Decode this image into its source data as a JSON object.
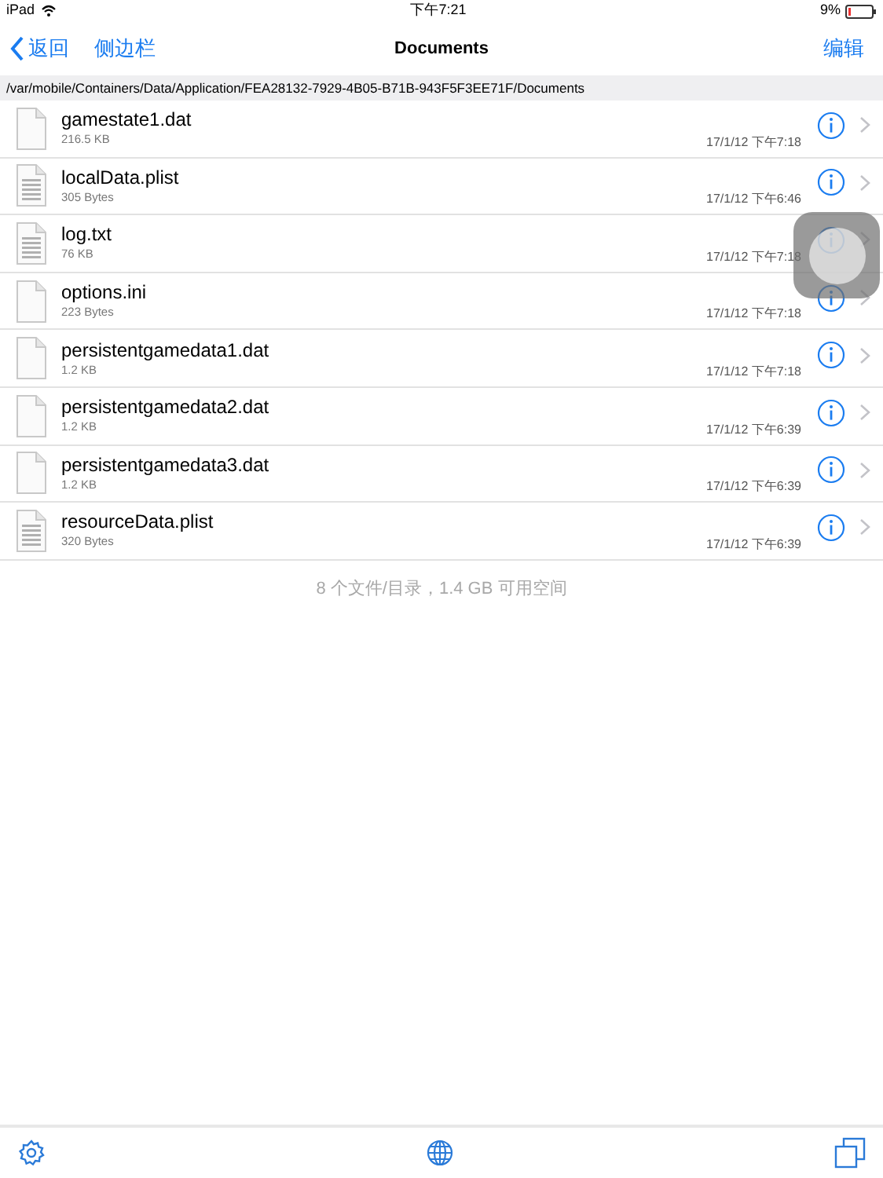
{
  "status_bar": {
    "device": "iPad",
    "time": "下午7:21",
    "battery": "9%"
  },
  "nav": {
    "back": "返回",
    "sidebar": "侧边栏",
    "title": "Documents",
    "edit": "编辑"
  },
  "path": "/var/mobile/Containers/Data/Application/FEA28132-7929-4B05-B71B-943F5F3EE71F/Documents",
  "files": [
    {
      "name": "gamestate1.dat",
      "size": "216.5 KB",
      "date": "17/1/12 下午7:18",
      "kind": "blank"
    },
    {
      "name": "localData.plist",
      "size": "305 Bytes",
      "date": "17/1/12 下午6:46",
      "kind": "text"
    },
    {
      "name": "log.txt",
      "size": "76 KB",
      "date": "17/1/12 下午7:18",
      "kind": "text"
    },
    {
      "name": "options.ini",
      "size": "223 Bytes",
      "date": "17/1/12 下午7:18",
      "kind": "blank"
    },
    {
      "name": "persistentgamedata1.dat",
      "size": "1.2 KB",
      "date": "17/1/12 下午7:18",
      "kind": "blank"
    },
    {
      "name": "persistentgamedata2.dat",
      "size": "1.2 KB",
      "date": "17/1/12 下午6:39",
      "kind": "blank"
    },
    {
      "name": "persistentgamedata3.dat",
      "size": "1.2 KB",
      "date": "17/1/12 下午6:39",
      "kind": "blank"
    },
    {
      "name": "resourceData.plist",
      "size": "320 Bytes",
      "date": "17/1/12 下午6:39",
      "kind": "text"
    }
  ],
  "summary": "8 个文件/目录，1.4 GB 可用空间"
}
